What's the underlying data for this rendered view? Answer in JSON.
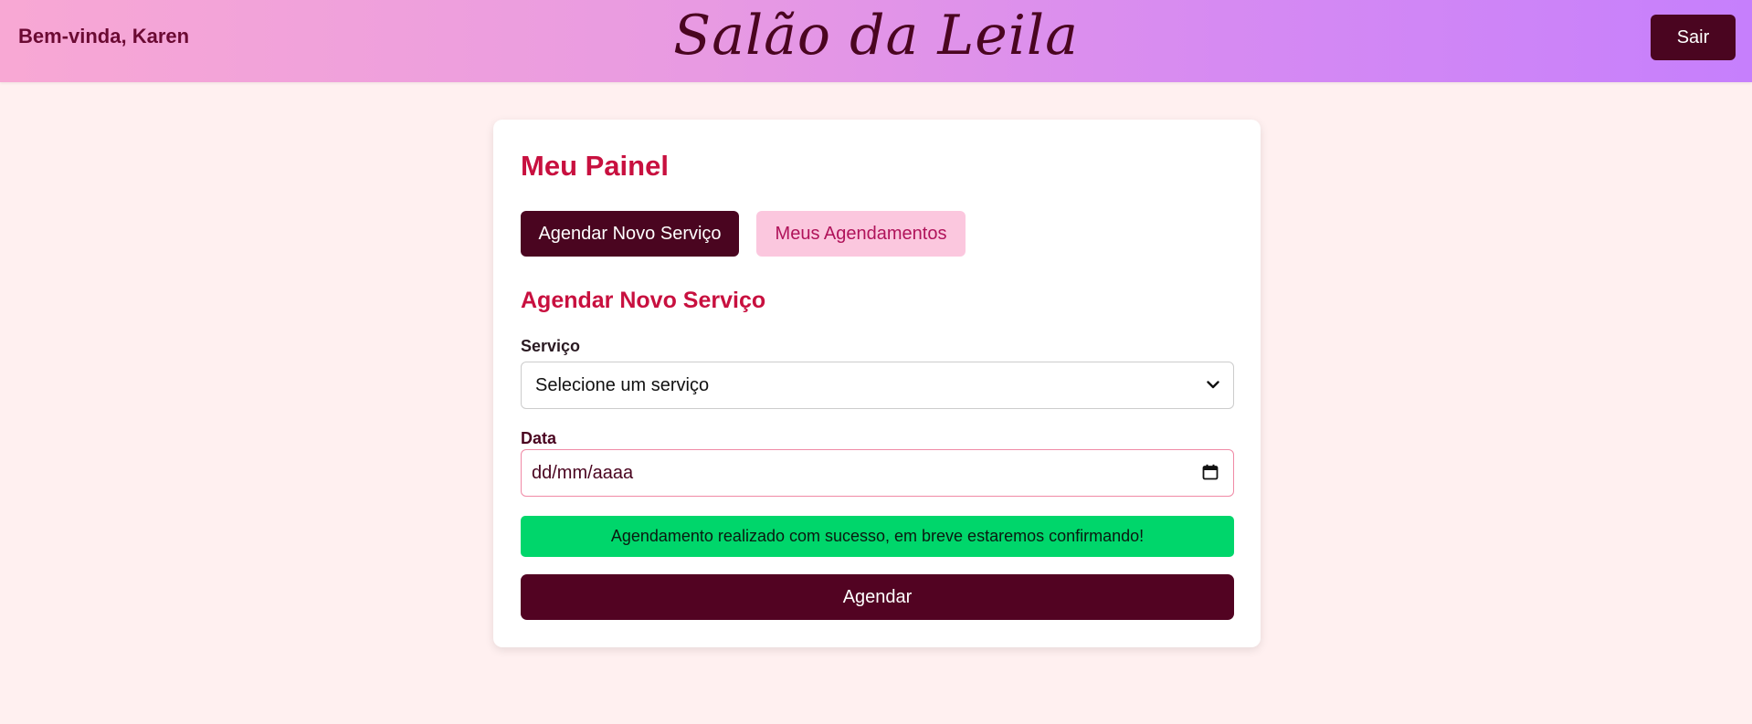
{
  "header": {
    "greeting": "Bem-vinda, Karen",
    "brand": "Salão da Leila",
    "logout_label": "Sair"
  },
  "panel": {
    "title": "Meu Painel",
    "tabs": [
      {
        "label": "Agendar Novo Serviço",
        "active": true
      },
      {
        "label": "Meus Agendamentos",
        "active": false
      }
    ],
    "section_title": "Agendar Novo Serviço",
    "service_label": "Serviço",
    "service_selected": "Selecione um serviço",
    "date_label": "Data",
    "date_value": "dd/mm/aaaa",
    "success_message": "Agendamento realizado com sucesso, em breve estaremos confirmando!",
    "submit_label": "Agendar"
  },
  "icons": {
    "select": "chevron-down-icon",
    "date": "calendar-icon"
  },
  "colors": {
    "accent": "#c8103f",
    "primary_dark": "#4a0520",
    "tab_inactive_bg": "#fbc7de",
    "success_bg": "#00d66b",
    "page_bg": "#fff0f0",
    "header_gradient_start": "#f8a8d4",
    "header_gradient_end": "#c67ffc"
  }
}
